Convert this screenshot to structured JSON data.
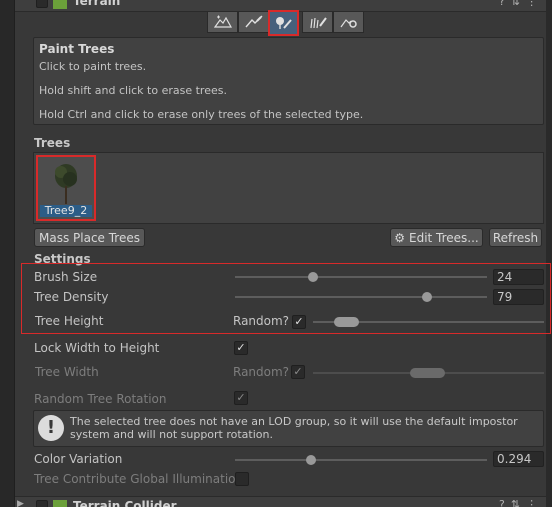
{
  "component_top": {
    "title": "Terrain",
    "icons": [
      "help-icon",
      "preset-icon",
      "more-icon"
    ]
  },
  "toolbar": {
    "tools": [
      {
        "name": "raise-lower-terrain-tool"
      },
      {
        "name": "paint-texture-tool"
      },
      {
        "name": "paint-trees-tool",
        "active": true
      },
      {
        "name": "paint-details-tool"
      },
      {
        "name": "terrain-settings-tool"
      }
    ]
  },
  "info": {
    "title": "Paint Trees",
    "line1": "Click to paint trees.",
    "line2": "Hold shift and click to erase trees.",
    "line3": "Hold Ctrl and click to erase only trees of the selected type."
  },
  "trees": {
    "label": "Trees",
    "items": [
      {
        "name": "Tree9_2",
        "selected": true
      }
    ]
  },
  "buttons": {
    "mass_place": "Mass Place Trees",
    "edit_trees": "Edit Trees...",
    "refresh": "Refresh"
  },
  "settings": {
    "label": "Settings",
    "brush_size": {
      "label": "Brush Size",
      "value": "24",
      "fraction": 0.31
    },
    "tree_density": {
      "label": "Tree Density",
      "value": "79",
      "fraction": 0.76
    },
    "tree_height": {
      "label": "Tree Height",
      "random_label": "Random?",
      "random_checked": true,
      "range": [
        0.09,
        0.2
      ]
    },
    "lock_width": {
      "label": "Lock Width to Height",
      "checked": true
    },
    "tree_width": {
      "label": "Tree Width",
      "random_label": "Random?",
      "random_checked": true,
      "range": [
        0.42,
        0.57
      ]
    },
    "random_rotation": {
      "label": "Random Tree Rotation",
      "checked": true
    },
    "warning": "The selected tree does not have an LOD group, so it will use the default impostor system and will not support rotation.",
    "color_variation": {
      "label": "Color Variation",
      "value": "0.294",
      "fraction": 0.3
    },
    "contribute_gi": {
      "label": "Tree Contribute Global Illumination",
      "checked": false
    }
  },
  "component_bottom": {
    "title": "Terrain Collider",
    "icons": [
      "help-icon",
      "preset-icon",
      "more-icon"
    ]
  },
  "colors": {
    "accent": "#2c5d87",
    "highlight": "#d82a2a",
    "background": "#383838"
  }
}
